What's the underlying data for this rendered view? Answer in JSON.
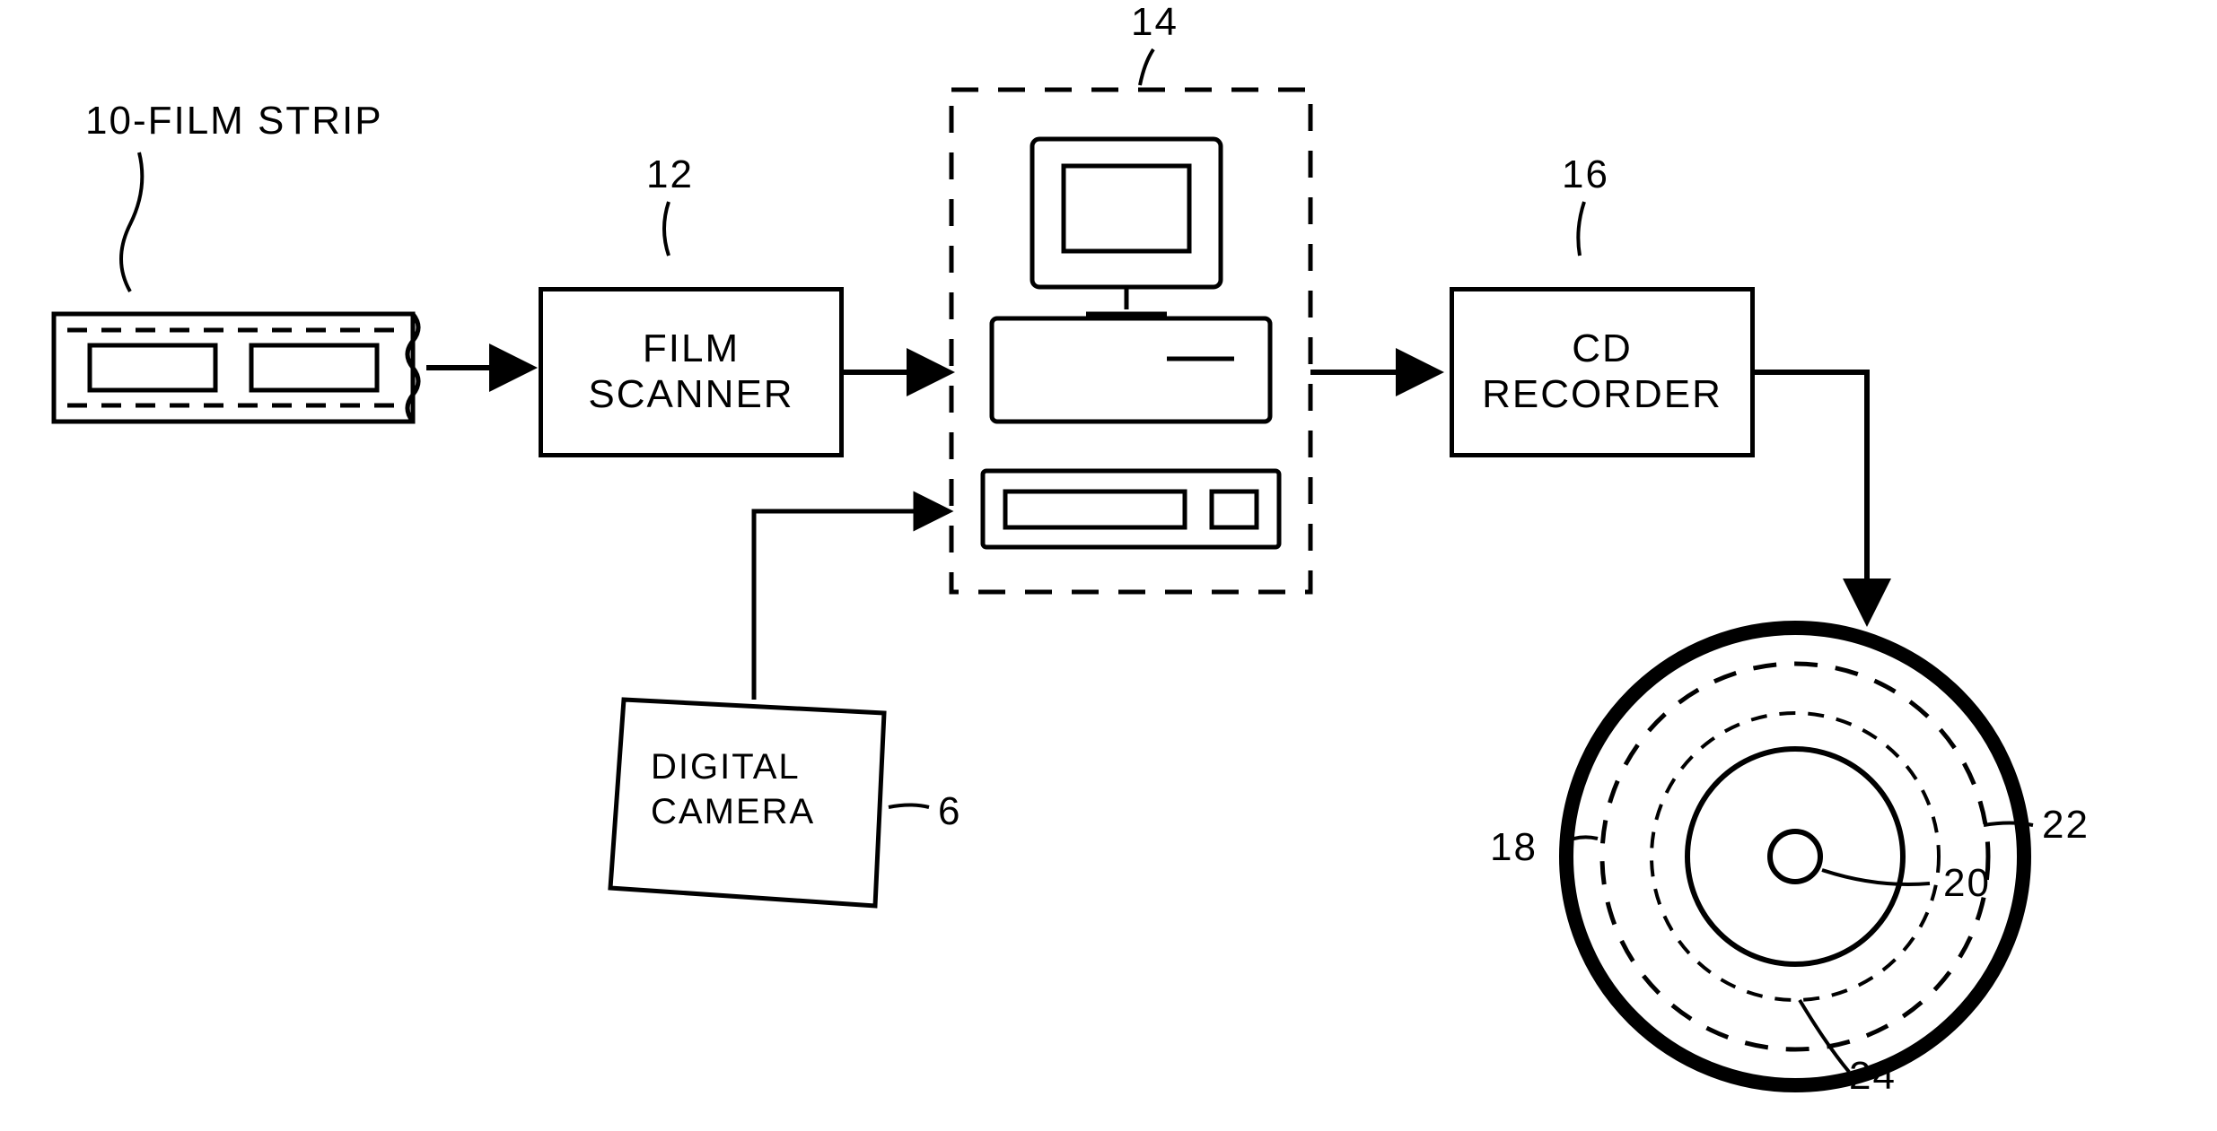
{
  "labels": {
    "film_strip_ref": "10-FILM STRIP",
    "film_scanner_ref": "12",
    "computer_ref": "14",
    "cd_recorder_ref": "16",
    "disc_outer_ref": "18",
    "disc_hub_ref": "20",
    "disc_dashed_ref": "22",
    "disc_inner_dashed_ref": "24"
  },
  "blocks": {
    "film_scanner": "FILM\nSCANNER",
    "cd_recorder": "CD\nRECORDER",
    "digital_camera": "DIGITAL\nCAMERA",
    "digital_camera_ref": "6"
  }
}
